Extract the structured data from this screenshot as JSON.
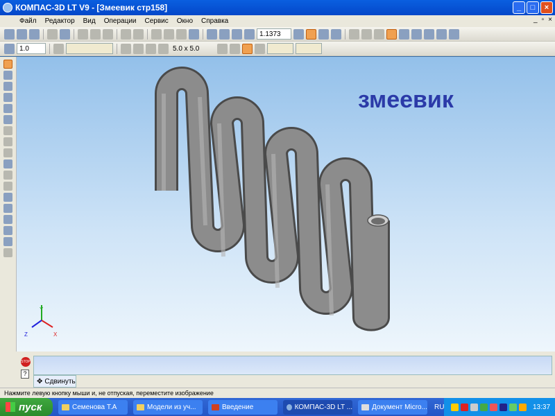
{
  "window": {
    "title": "КОМПАС-3D LT V9 - [Змеевик  стр158]",
    "minimize": "_",
    "maximize": "□",
    "close": "×"
  },
  "menu": [
    "Файл",
    "Редактор",
    "Вид",
    "Операции",
    "Сервис",
    "Окно",
    "Справка"
  ],
  "mdi": {
    "minimize": "_",
    "restore": "▫",
    "close": "×"
  },
  "toolbar": {
    "zoom_value": "1.1373",
    "line_step": "1.0",
    "grid_step": "5.0 x 5.0"
  },
  "viewport": {
    "caption": "змеевик",
    "axes": {
      "x": "X",
      "y": "Y",
      "z": "Z"
    }
  },
  "bottom": {
    "stop_label": "STOP",
    "help_label": "?",
    "tab_label": "Сдвинуть"
  },
  "status": "Нажмите левую кнопку мыши и, не отпуская, переместите изображение",
  "taskbar": {
    "start": "пуск",
    "tasks": [
      "Семенова Т.А",
      "Модели  из  уч...",
      "Введение",
      "КОМПАС-3D LT ...",
      "Документ Micro..."
    ],
    "lang": "RU",
    "clock": "13:37"
  },
  "colors": {
    "caption": "#2b3aa8",
    "pipe": "#8a8a8a"
  }
}
